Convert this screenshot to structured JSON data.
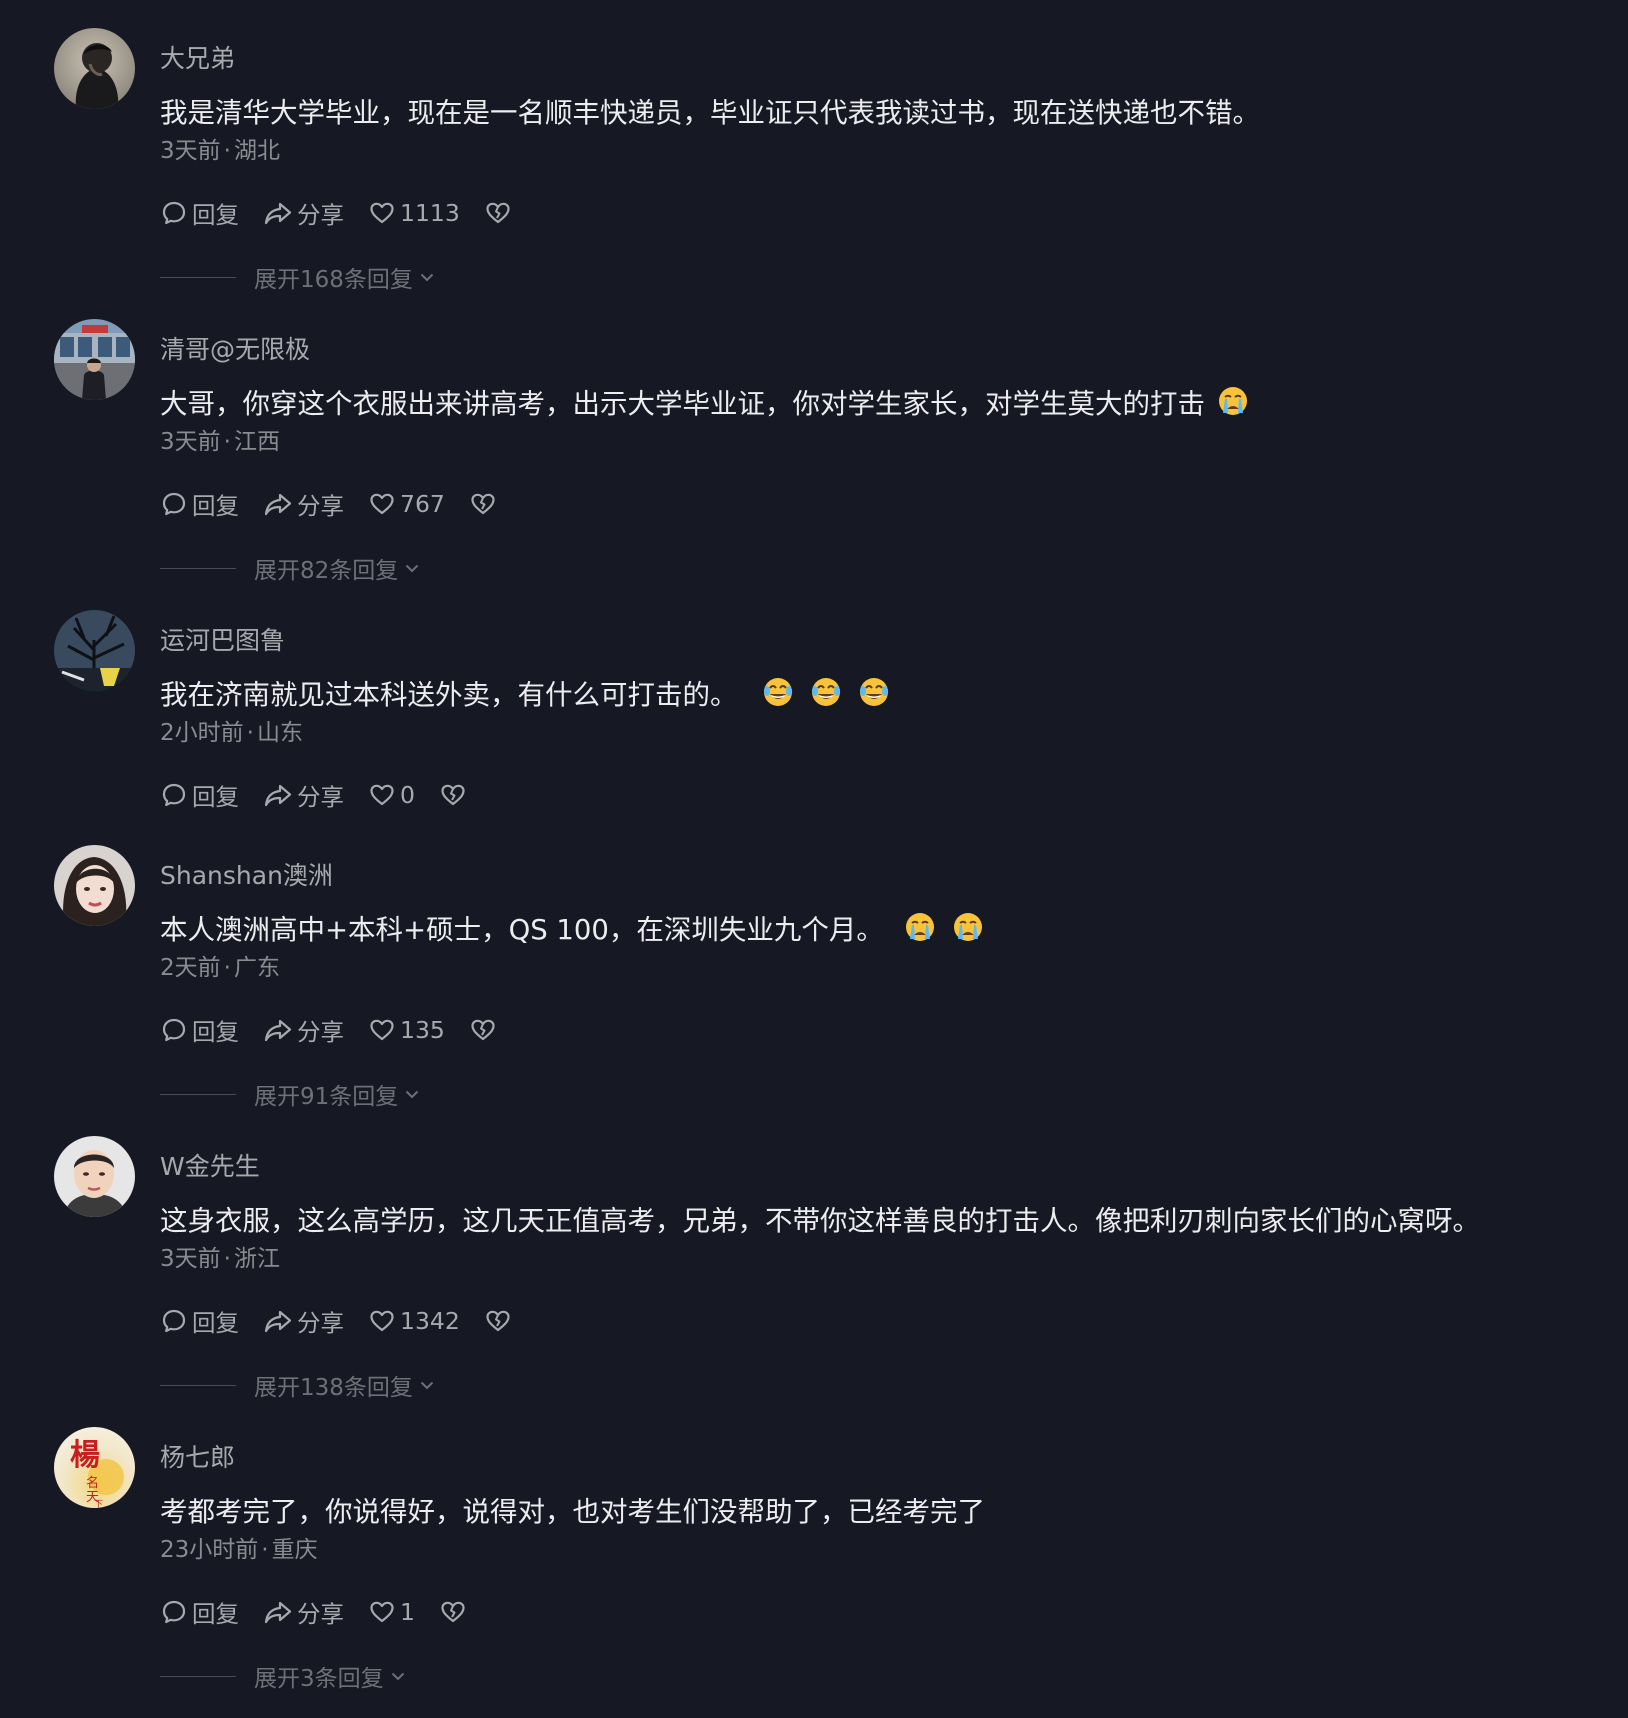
{
  "comments": [
    {
      "username": "大兄弟",
      "text": "我是清华大学毕业，现在是一名顺丰快递员，毕业证只代表我读过书，现在送快递也不错。",
      "emojis": [],
      "time": "3天前",
      "location": "湖北",
      "reply_label": "回复",
      "share_label": "分享",
      "likes": "1113",
      "expand_label": "展开168条回复",
      "avatar_icon": "man-on-phone-avatar"
    },
    {
      "username": "清哥@无限极",
      "text": "大哥，你穿这个衣服出来讲高考，出示大学毕业证，你对学生家长，对学生莫大的打击",
      "emojis": [
        "crying-face-emoji"
      ],
      "time": "3天前",
      "location": "江西",
      "reply_label": "回复",
      "share_label": "分享",
      "likes": "767",
      "expand_label": "展开82条回复",
      "avatar_icon": "man-in-front-of-building-avatar"
    },
    {
      "username": "运河巴图鲁",
      "text": "我在济南就见过本科送外卖，有什么可打击的。",
      "emojis": [
        "tears-of-joy-emoji",
        "tears-of-joy-emoji",
        "tears-of-joy-emoji"
      ],
      "time": "2小时前",
      "location": "山东",
      "reply_label": "回复",
      "share_label": "分享",
      "likes": "0",
      "expand_label": "",
      "avatar_icon": "dark-tree-scene-avatar"
    },
    {
      "username": "Shanshan澳洲",
      "text": "本人澳洲高中+本科+硕士，QS 100，在深圳失业九个月。",
      "emojis": [
        "crying-face-emoji",
        "crying-face-emoji"
      ],
      "time": "2天前",
      "location": "广东",
      "reply_label": "回复",
      "share_label": "分享",
      "likes": "135",
      "expand_label": "展开91条回复",
      "avatar_icon": "woman-portrait-avatar"
    },
    {
      "username": "W金先生",
      "text": "这身衣服，这么高学历，这几天正值高考，兄弟，不带你这样善良的打击人。像把利刃刺向家长们的心窝呀。",
      "emojis": [],
      "time": "3天前",
      "location": "浙江",
      "reply_label": "回复",
      "share_label": "分享",
      "likes": "1342",
      "expand_label": "展开138条回复",
      "avatar_icon": "man-portrait-avatar"
    },
    {
      "username": "杨七郎",
      "text": "考都考完了，你说得好，说得对，也对考生们没帮助了，已经考完了",
      "emojis": [],
      "time": "23小时前",
      "location": "重庆",
      "reply_label": "回复",
      "share_label": "分享",
      "likes": "1",
      "expand_label": "展开3条回复",
      "avatar_icon": "calligraphy-yang-avatar",
      "avatar_text": "楊"
    }
  ],
  "meta_separator": "·",
  "colors": {
    "background": "#161823",
    "username": "#a8a9ae",
    "content": "#ededf0",
    "meta": "#8a8b91",
    "expand": "#6f7077"
  }
}
